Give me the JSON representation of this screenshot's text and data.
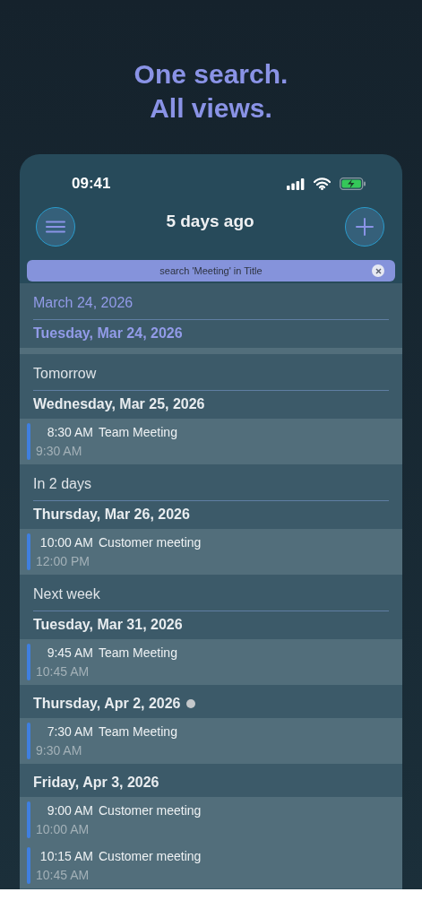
{
  "headline": [
    "One search.",
    "All views."
  ],
  "status_bar": {
    "time": "09:41"
  },
  "nav": {
    "title": "5 days ago"
  },
  "filter": {
    "text": "search 'Meeting' in Title"
  },
  "groups": [
    {
      "label": "March 24, 2026",
      "current": true,
      "days": [
        {
          "date": "Tuesday, Mar 24, 2026",
          "current": true,
          "dot": false
        }
      ]
    },
    {
      "label": "Tomorrow",
      "current": false,
      "days": [
        {
          "date": "Wednesday, Mar 25, 2026",
          "current": false,
          "dot": false,
          "events": [
            {
              "start": "8:30 AM",
              "title": "Team Meeting",
              "end": "9:30 AM",
              "color": "#3f7fe0"
            }
          ]
        }
      ]
    },
    {
      "label": "In 2 days",
      "current": false,
      "days": [
        {
          "date": "Thursday, Mar 26, 2026",
          "current": false,
          "dot": false,
          "events": [
            {
              "start": "10:00 AM",
              "title": "Customer meeting",
              "end": "12:00 PM",
              "color": "#3f7fe0"
            }
          ]
        }
      ]
    },
    {
      "label": "Next week",
      "current": false,
      "days": [
        {
          "date": "Tuesday, Mar 31, 2026",
          "current": false,
          "dot": false,
          "events": [
            {
              "start": "9:45 AM",
              "title": "Team Meeting",
              "end": "10:45 AM",
              "color": "#3f7fe0"
            }
          ]
        },
        {
          "date": "Thursday, Apr 2, 2026",
          "current": false,
          "dot": true,
          "events": [
            {
              "start": "7:30 AM",
              "title": "Team Meeting",
              "end": "9:30 AM",
              "color": "#3f7fe0"
            }
          ]
        },
        {
          "date": "Friday, Apr 3, 2026",
          "current": false,
          "dot": false,
          "events": [
            {
              "start": "9:00 AM",
              "title": "Customer meeting",
              "end": "10:00 AM",
              "color": "#3f7fe0"
            },
            {
              "start": "10:15 AM",
              "title": "Customer meeting",
              "end": "10:45 AM",
              "color": "#3f7fe0"
            }
          ]
        }
      ]
    }
  ]
}
